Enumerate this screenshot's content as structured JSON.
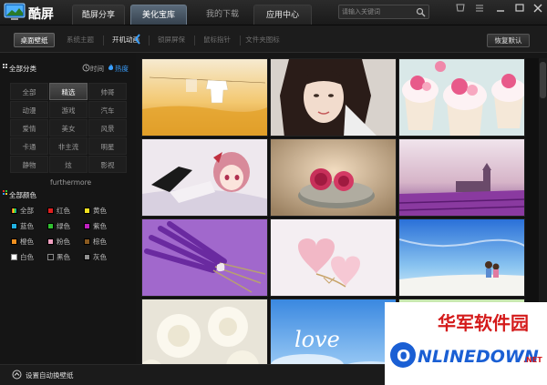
{
  "app": {
    "name": "酷屏"
  },
  "main_tabs": [
    {
      "label": "酷屏分享",
      "active": false
    },
    {
      "label": "美化宝库",
      "active": true
    },
    {
      "label": "我的下载",
      "active": false
    },
    {
      "label": "应用中心",
      "active": false
    }
  ],
  "search": {
    "placeholder": "请输入关键词"
  },
  "sub_tabs": [
    {
      "label": "桌面壁纸",
      "active": true
    },
    {
      "label": "系统主题",
      "active": false
    },
    {
      "label": "开机动画",
      "active": false
    },
    {
      "label": "锁屏屏保",
      "active": false
    },
    {
      "label": "鼠标指针",
      "active": false
    },
    {
      "label": "文件夹图标",
      "active": false
    }
  ],
  "restore_button": "恢复默认",
  "sidebar": {
    "category_title": "全部分类",
    "sort_time": "时间",
    "sort_hot": "热度",
    "categories": [
      "全部",
      "精选",
      "帅哥",
      "动漫",
      "游戏",
      "汽车",
      "爱情",
      "美女",
      "风景",
      "卡通",
      "非主流",
      "明星",
      "静物",
      "炫furthermore",
      "影视"
    ],
    "color_title": "全部颜色",
    "colors": [
      {
        "label": "全部",
        "color": "multi"
      },
      {
        "label": "红色",
        "color": "#e02020"
      },
      {
        "label": "黄色",
        "color": "#f0e020"
      },
      {
        "label": "蓝色",
        "color": "#20b0e0"
      },
      {
        "label": "绿色",
        "color": "#30c030"
      },
      {
        "label": "紫色",
        "color": "#c020c0"
      },
      {
        "label": "橙色",
        "color": "#f09020"
      },
      {
        "label": "粉色",
        "color": "#f0a0c0"
      },
      {
        "label": "棕色",
        "color": "#8a5a20"
      },
      {
        "label": "白色",
        "color": "#ffffff"
      },
      {
        "label": "黑色",
        "color": "#111111"
      },
      {
        "label": "灰色",
        "color": "#909090"
      }
    ]
  },
  "thumbnails": [
    {
      "name": "clothesline-field"
    },
    {
      "name": "girl-portrait"
    },
    {
      "name": "cupcakes"
    },
    {
      "name": "anime-girl"
    },
    {
      "name": "roses-on-stone"
    },
    {
      "name": "lavender-castle"
    },
    {
      "name": "lavender-bunch"
    },
    {
      "name": "heart-leaves"
    },
    {
      "name": "beach-couple"
    },
    {
      "name": "white-roses"
    },
    {
      "name": "love-sky"
    },
    {
      "name": "green-partial"
    }
  ],
  "love_text": "love",
  "bottom": {
    "auto_change": "设置自动换壁纸"
  },
  "watermark": {
    "cn": "华军软件园",
    "en": "ONLINEDOWN",
    "suffix": ".NET"
  },
  "colors": {
    "accent": "#3aa0ff",
    "active_tab": "#4a5a6a"
  }
}
